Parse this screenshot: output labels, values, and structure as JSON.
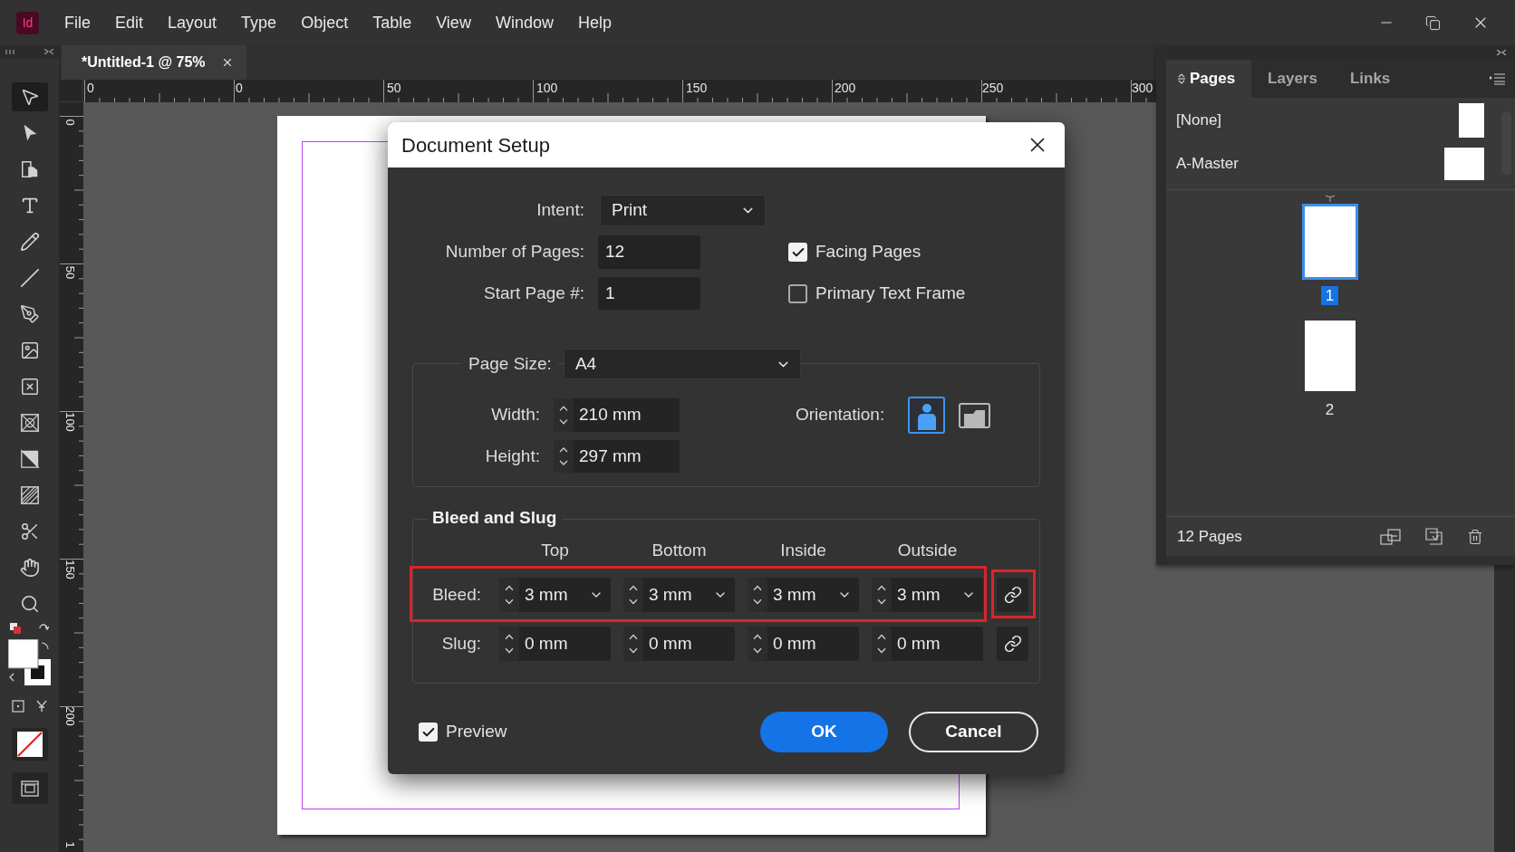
{
  "app_logo": "Id",
  "menu_bar": {
    "items": [
      "File",
      "Edit",
      "Layout",
      "Type",
      "Object",
      "Table",
      "View",
      "Window",
      "Help"
    ]
  },
  "toolbar": {
    "tools": [
      {
        "kind": "selection",
        "selected": true
      },
      {
        "kind": "direct-selection",
        "selected": false
      },
      {
        "kind": "page",
        "selected": false
      },
      {
        "kind": "type",
        "selected": false
      },
      {
        "kind": "pencil",
        "selected": false
      },
      {
        "kind": "line",
        "selected": false
      },
      {
        "kind": "pen",
        "selected": false
      },
      {
        "kind": "image-frame",
        "selected": false
      },
      {
        "kind": "rectangle-frame",
        "selected": false
      },
      {
        "kind": "ellipse-frame",
        "selected": false
      },
      {
        "kind": "gradient",
        "selected": false
      },
      {
        "kind": "gradient-feather",
        "selected": false
      },
      {
        "kind": "scissors",
        "selected": false
      },
      {
        "kind": "hand",
        "selected": false
      },
      {
        "kind": "zoom",
        "selected": false
      }
    ]
  },
  "document_tab": {
    "title": "*Untitled-1 @ 75%"
  },
  "horizontal_ruler": {
    "labels": [
      "0",
      "0",
      "50",
      "100",
      "150",
      "200",
      "250",
      "300"
    ]
  },
  "vertical_ruler": {
    "labels": [
      "0",
      "50",
      "100",
      "150",
      "200",
      "1"
    ]
  },
  "dialog": {
    "title": "Document Setup",
    "intent": {
      "label": "Intent:",
      "value": "Print"
    },
    "number_of_pages": {
      "label": "Number of Pages:",
      "value": "12"
    },
    "start_page": {
      "label": "Start Page #:",
      "value": "1"
    },
    "options": [
      {
        "label": "Facing Pages",
        "checked": true
      },
      {
        "label": "Primary Text Frame",
        "checked": false
      }
    ],
    "page_size": {
      "label": "Page Size:",
      "value": "A4",
      "width": {
        "label": "Width:",
        "value": "210 mm"
      },
      "height": {
        "label": "Height:",
        "value": "297 mm"
      },
      "orientation": {
        "label": "Orientation:",
        "options": [
          {
            "kind": "portrait",
            "selected": true
          },
          {
            "kind": "landscape",
            "selected": false
          }
        ]
      }
    },
    "bleed_and_slug": {
      "title": "Bleed and Slug",
      "columns": [
        "Top",
        "Bottom",
        "Inside",
        "Outside"
      ],
      "rows": [
        {
          "label": "Bleed:",
          "kind": "dropdown",
          "values": [
            "3 mm",
            "3 mm",
            "3 mm",
            "3 mm"
          ],
          "highlighted": true,
          "link_highlighted": true
        },
        {
          "label": "Slug:",
          "kind": "number",
          "values": [
            "0 mm",
            "0 mm",
            "0 mm",
            "0 mm"
          ],
          "highlighted": false,
          "link_highlighted": false
        }
      ]
    },
    "preview": {
      "label": "Preview",
      "checked": true
    },
    "buttons": [
      {
        "label": "OK",
        "kind": "primary"
      },
      {
        "label": "Cancel",
        "kind": "secondary"
      }
    ]
  },
  "pages_panel": {
    "tabs": [
      {
        "label": "Pages",
        "selected": true
      },
      {
        "label": "Layers",
        "selected": false
      },
      {
        "label": "Links",
        "selected": false
      }
    ],
    "masters": [
      {
        "name": "[None]",
        "kind": "single"
      },
      {
        "name": "A-Master",
        "kind": "spread"
      }
    ],
    "pages": [
      {
        "number": "1",
        "selected": true
      },
      {
        "number": "2",
        "selected": false
      }
    ],
    "page_count": "12 Pages"
  }
}
